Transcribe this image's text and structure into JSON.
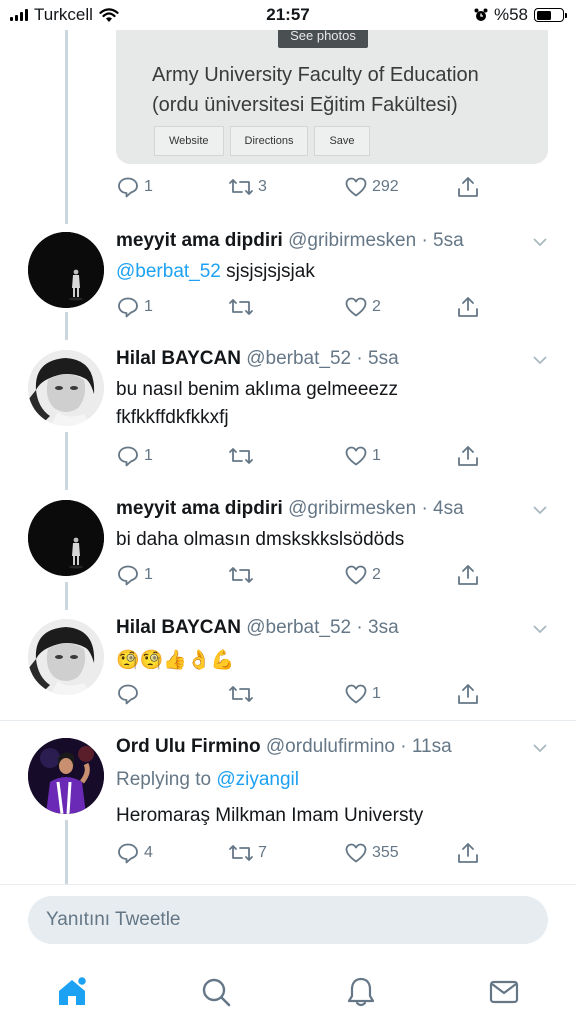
{
  "status_bar": {
    "carrier": "Turkcell",
    "time": "21:57",
    "battery_label": "%58",
    "battery_level": 0.58
  },
  "card": {
    "see_photos": "See photos",
    "title_line1": "Army University Faculty of Education",
    "title_line2": "(ordu üniversitesi Eğitim Fakültesi)",
    "buttons": [
      "Website",
      "Directions",
      "Save"
    ],
    "replies": "1",
    "retweets": "3",
    "likes": "292"
  },
  "tweets": [
    {
      "name": "meyyit ama dipdiri",
      "handle": "@gribirmesken",
      "time": "· 5sa",
      "mention": "@berbat_52",
      "text": " sjsjsjsjsjak",
      "replies": "1",
      "retweets": "",
      "likes": "2",
      "avatar": "dark"
    },
    {
      "name": "Hilal BAYCAN",
      "handle": "@berbat_52",
      "time": "· 5sa",
      "line1": "bu nasıl benim aklıma gelmeeezz",
      "line2": "fkfkkffdkfkkxfj",
      "replies": "1",
      "retweets": "",
      "likes": "1",
      "avatar": "hilal"
    },
    {
      "name": "meyyit ama dipdiri",
      "handle": "@gribirmesken",
      "time": "· 4sa",
      "text": "bi daha olmasın dmskskkslsödöds",
      "replies": "1",
      "retweets": "",
      "likes": "2",
      "avatar": "dark"
    },
    {
      "name": "Hilal BAYCAN",
      "handle": "@berbat_52",
      "time": "· 3sa",
      "text": "🧐🧐👍👌💪",
      "replies": "",
      "retweets": "",
      "likes": "1",
      "avatar": "hilal"
    },
    {
      "name": "Ord Ulu Firmino",
      "handle": "@ordulufirmino",
      "time": "· 11sa",
      "replying_prefix": "Replying to ",
      "replying_handle": "@ziyangil",
      "text": "Heromaraş Milkman Imam Universty",
      "replies": "4",
      "retweets": "7",
      "likes": "355",
      "avatar": "firmino"
    }
  ],
  "reply_box": {
    "placeholder": "Yanıtını Tweetle"
  },
  "tabs": [
    "home-icon",
    "search-icon",
    "notifications-icon",
    "messages-icon"
  ],
  "colors": {
    "accent": "#1da1f2",
    "muted": "#657786",
    "divider": "#e6ecf0"
  }
}
